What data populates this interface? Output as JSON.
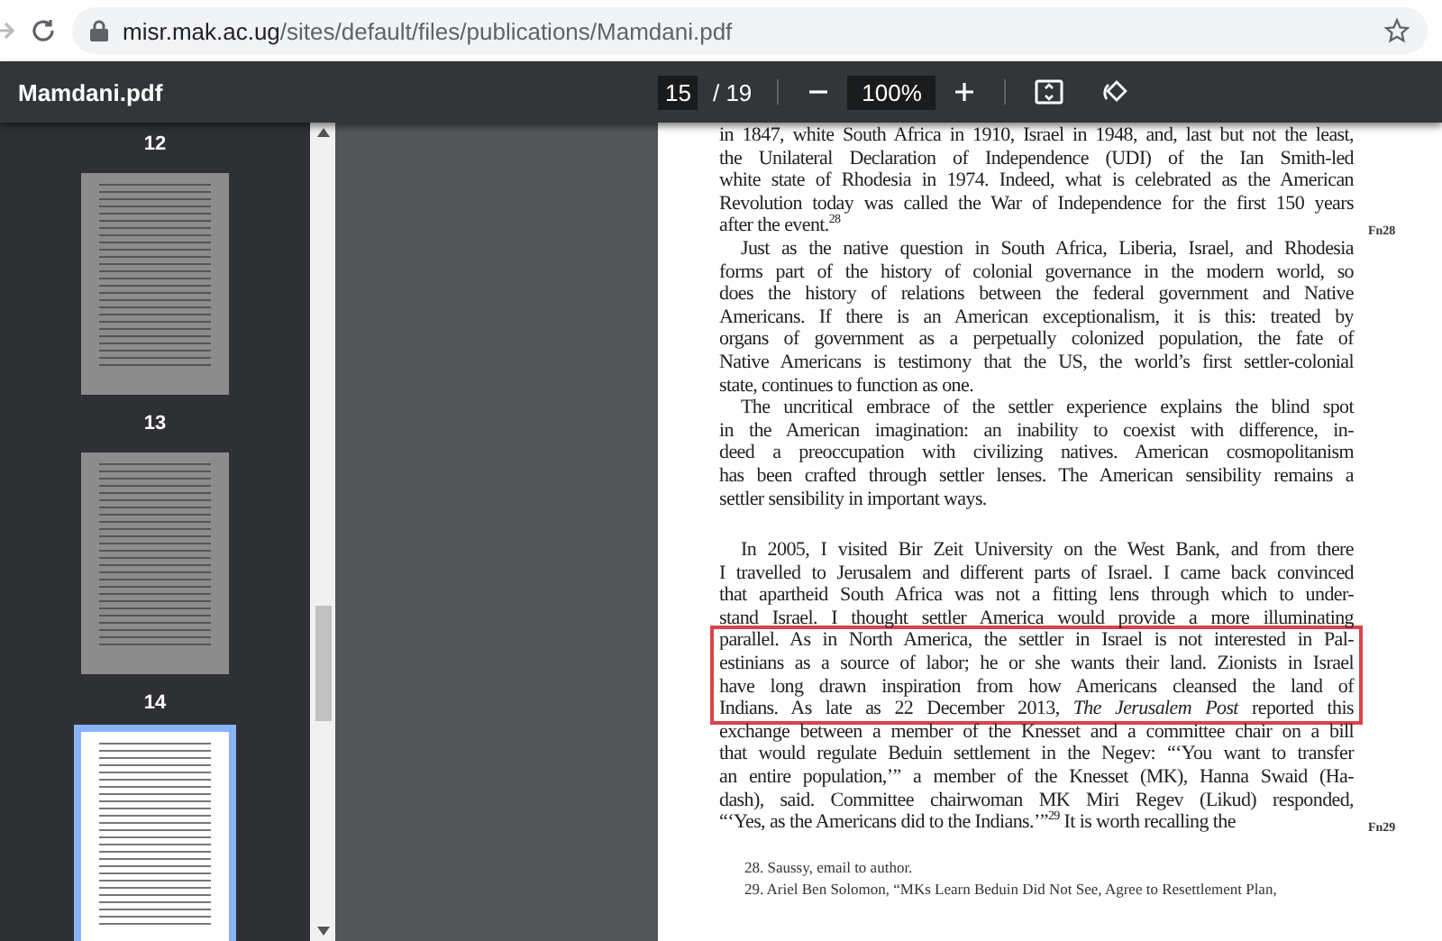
{
  "browser": {
    "url_host": "misr.mak.ac.ug",
    "url_path": "/sites/default/files/publications/Mamdani.pdf"
  },
  "toolbar": {
    "title": "Mamdani.pdf",
    "page": "15",
    "page_total": "/ 19",
    "zoom": "100%"
  },
  "sidebar": {
    "top_label": "12",
    "thumbnails": [
      {
        "label": "13",
        "selected": false
      },
      {
        "label": "14",
        "selected": false
      },
      {
        "selected": true
      }
    ]
  },
  "page": {
    "paragraphs": [
      {
        "indent": false,
        "note": "Fn28",
        "segments": [
          {
            "highlighted": false,
            "lines": [
              "in 1847, white South Africa in 1910, Israel in 1948, and, last but not the least,",
              "the Unilateral Declaration of Independence (UDI) of the Ian Smith-led",
              "white state of Rhodesia in 1974. Indeed, what is celebrated as the American",
              "Revolution today was called the War of Independence for the first 150 years",
              "after the event.$^{28}$"
            ]
          }
        ]
      },
      {
        "indent": true,
        "segments": [
          {
            "highlighted": false,
            "lines": [
              "Just as the native question in South Africa, Liberia, Israel, and Rhodesia",
              "forms part of the history of colonial governance in the modern world, so",
              "does the history of relations between the federal government and Native",
              "Americans. If there is an American exceptionalism, it is this: treated by",
              "organs of government as a perpetually colonized population, the fate of",
              "Native Americans is testimony that the US, the world’s first settler-colonial",
              "state, continues to function as one."
            ]
          }
        ]
      },
      {
        "indent": true,
        "segments": [
          {
            "highlighted": false,
            "lines": [
              "The uncritical embrace of the settler experience explains the blind spot",
              "in the American imagination: an inability to coexist with difference, in-",
              "deed a preoccupation with civilizing natives. American cosmopolitanism",
              "has been crafted through settler lenses. The American sensibility remains a",
              "settler sensibility in important ways."
            ]
          }
        ]
      },
      {
        "indent": true,
        "note": "Fn29",
        "segments": [
          {
            "highlighted": false,
            "lines": [
              "In 2005, I visited Bir Zeit University on the West Bank, and from there",
              "I travelled to Jerusalem and different parts of Israel. I came back convinced",
              "that apartheid South Africa was not a fitting lens through which to under-",
              "stand Israel. I thought settler America would provide a more illuminating"
            ]
          },
          {
            "highlighted": true,
            "lines": [
              "parallel. As in North America, the settler in Israel is not interested in Pal-",
              "estinians as a source of labor; he or she wants their land. Zionists in Israel",
              "have long drawn inspiration from how Americans cleansed the land of",
              "Indians. As late as 22 December 2013, *The Jerusalem Post* reported this"
            ]
          },
          {
            "highlighted": false,
            "lines": [
              "exchange between a member of the Knesset and a committee chair on a bill",
              "that would regulate Beduin settlement in the Negev: “‘You want to transfer",
              "an entire population,’” a member of the Knesset (MK), Hanna Swaid (Ha-",
              "dash), said. Committee chairwoman MK Miri Regev (Likud) responded,",
              "“‘Yes, as the Americans did to the Indians.’”$^{29}$ It is worth recalling the"
            ]
          }
        ]
      }
    ],
    "footnotes": [
      "28.  Saussy, email to author.",
      "29.  Ariel Ben Solomon, “MKs Learn Beduin Did Not See, Agree to Resettlement Plan,"
    ]
  }
}
